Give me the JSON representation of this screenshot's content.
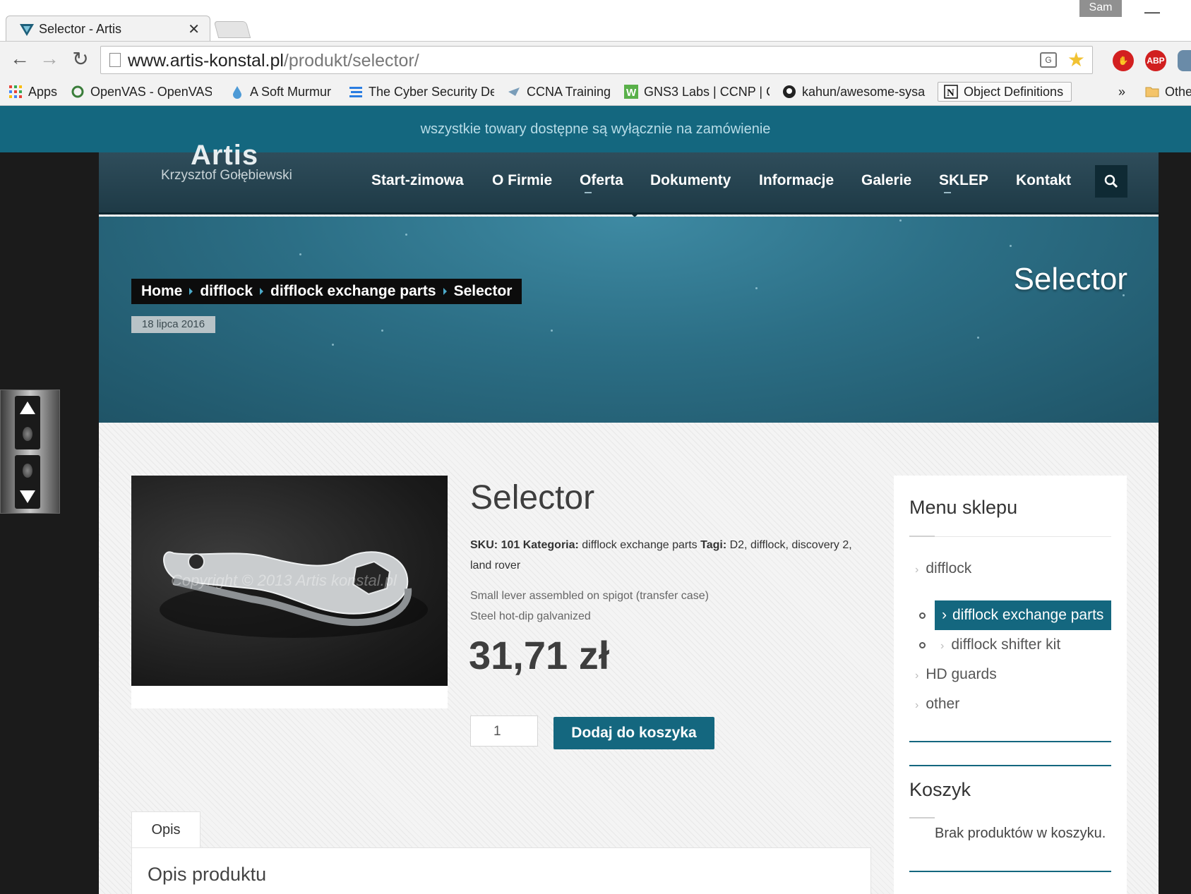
{
  "browser": {
    "tab_title": "Selector - Artis",
    "profile": "Sam",
    "url_host": "www.artis-konstal.pl",
    "url_path": "/produkt/selector/",
    "bookmarks": [
      {
        "label": "Apps",
        "icon": "apps-grid-icon"
      },
      {
        "label": "OpenVAS - OpenVAS",
        "icon": "openvas-icon"
      },
      {
        "label": "A Soft Murmur",
        "icon": "droplet-icon"
      },
      {
        "label": "The Cyber Security De",
        "icon": "lines-icon"
      },
      {
        "label": "CCNA Training",
        "icon": "ccna-icon"
      },
      {
        "label": "GNS3 Labs | CCNP | C",
        "icon": "gns3-icon"
      },
      {
        "label": "kahun/awesome-sysa",
        "icon": "github-icon"
      },
      {
        "label": "Object Definitions",
        "icon": "notion-icon"
      },
      {
        "label": "Othe",
        "icon": "folder-icon"
      }
    ],
    "overflow": "»",
    "extensions": [
      "translate-icon",
      "star-icon",
      "hand-stop-icon",
      "adblock-icon",
      "cloud-icon"
    ],
    "ext_abp_label": "ABP"
  },
  "site": {
    "notice": "wszystkie towary dostępne są wyłącznie na zamówienie",
    "logo_main": "Artis",
    "logo_sub": "Krzysztof Gołębiewski",
    "nav": [
      "Start-zimowa",
      "O Firmie",
      "Oferta",
      "Dokumenty",
      "Informacje",
      "Galerie",
      "SKLEP",
      "Kontakt"
    ],
    "hero_title": "Selector",
    "breadcrumb": [
      "Home",
      "difflock",
      "difflock exchange parts",
      "Selector"
    ],
    "date": "18 lipca 2016"
  },
  "product": {
    "title": "Selector",
    "sku_label": "SKU:",
    "sku": "101",
    "category_label": "Kategoria:",
    "category": "difflock exchange parts",
    "tags_label": "Tagi:",
    "tags": "D2, difflock, discovery 2, land rover",
    "description": [
      "Small lever assembled on spigot (transfer case)",
      "Steel hot-dip galvanized"
    ],
    "price": "31,71 zł",
    "quantity": "1",
    "add_to_cart": "Dodaj do koszyka",
    "watermark": "Copyright © 2013 Artis konstal.pl",
    "tab_label": "Opis",
    "tab_heading": "Opis produktu"
  },
  "sidebar": {
    "menu_title": "Menu sklepu",
    "categories": [
      "difflock",
      "difflock exchange parts",
      "difflock shifter kit",
      "HD guards",
      "other"
    ],
    "cart_title": "Koszyk",
    "cart_empty": "Brak produktów w koszyku."
  },
  "colors": {
    "accent": "#14677f",
    "hero": "#2c6f86",
    "header": "#2f4d5b"
  }
}
